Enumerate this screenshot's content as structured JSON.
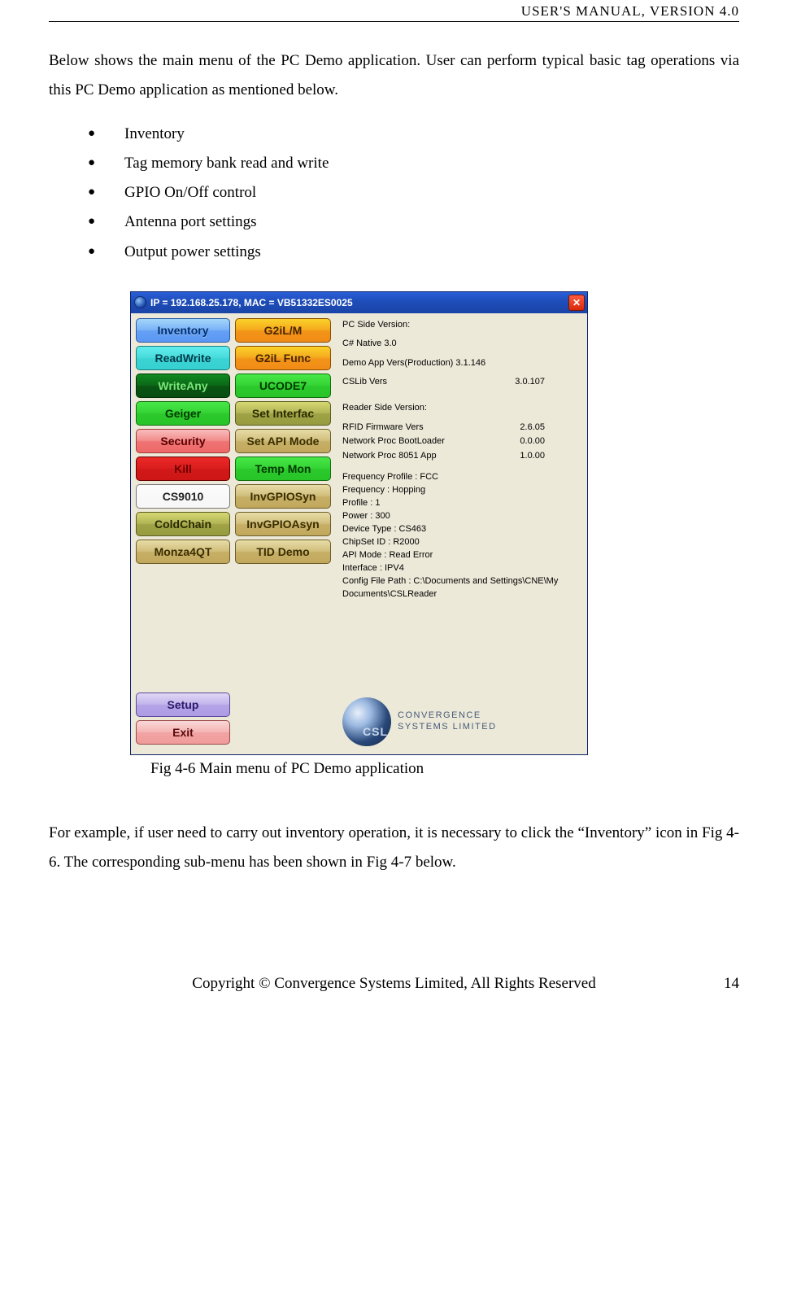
{
  "header": "USER'S  MANUAL,  VERSION  4.0",
  "intro": "Below shows the main menu of the PC Demo application. User can perform typical basic tag operations via this PC Demo application as mentioned below.",
  "features": [
    "Inventory",
    "Tag memory bank read and write",
    "GPIO On/Off control",
    "Antenna port settings",
    "Output power settings"
  ],
  "app": {
    "title": "IP = 192.168.25.178, MAC = VB51332ES0025",
    "close": "✕",
    "col1": [
      {
        "label": "Inventory",
        "cls": "b-blue"
      },
      {
        "label": "ReadWrite",
        "cls": "b-teal"
      },
      {
        "label": "WriteAny",
        "cls": "b-dgreen"
      },
      {
        "label": "Geiger",
        "cls": "b-green"
      },
      {
        "label": "Security",
        "cls": "b-salmon"
      },
      {
        "label": "Kill",
        "cls": "b-red"
      },
      {
        "label": "CS9010",
        "cls": "b-white"
      },
      {
        "label": "ColdChain",
        "cls": "b-olive"
      },
      {
        "label": "Monza4QT",
        "cls": "b-tan"
      }
    ],
    "col1_bottom": [
      {
        "label": "Setup",
        "cls": "b-violet"
      },
      {
        "label": "Exit",
        "cls": "b-pink"
      }
    ],
    "col2": [
      {
        "label": "G2iL/M",
        "cls": "b-orange"
      },
      {
        "label": "G2iL Func",
        "cls": "b-orange"
      },
      {
        "label": "UCODE7",
        "cls": "b-green"
      },
      {
        "label": "Set Interfac",
        "cls": "b-olive"
      },
      {
        "label": "Set API Mode",
        "cls": "b-tan"
      },
      {
        "label": "Temp Mon",
        "cls": "b-green"
      },
      {
        "label": "InvGPIOSyn",
        "cls": "b-tan"
      },
      {
        "label": "InvGPIOAsyn",
        "cls": "b-tan"
      },
      {
        "label": "TID Demo",
        "cls": "b-tan"
      }
    ],
    "info": {
      "pc_header": "PC Side Version:",
      "csharp": "C# Native 3.0",
      "demo_ver": "Demo App Vers(Production) 3.1.146",
      "cslib_lbl": "CSLib Vers",
      "cslib_val": "3.0.107",
      "reader_header": "Reader Side Version:",
      "rfid_lbl": "RFID Firmware Vers",
      "rfid_val": "2.6.05",
      "boot_lbl": "Network Proc BootLoader",
      "boot_val": "0.0.00",
      "net_lbl": "Network Proc  8051 App",
      "net_val": "1.0.00",
      "freq_profile": "Frequency Profile : FCC",
      "freq": "Frequency : Hopping",
      "profile": "Profile : 1",
      "power": "Power : 300",
      "device": "Device Type :  CS463",
      "chipset": "ChipSet ID : R2000",
      "api": "API Mode : Read Error",
      "iface": "Interface : IPV4",
      "cfg": "Config File Path : C:\\Documents and Settings\\CNE\\My Documents\\CSLReader"
    },
    "logo_line1": "CONVERGENCE",
    "logo_line2": "SYSTEMS LIMITED"
  },
  "caption": "Fig 4-6 Main menu of PC Demo application",
  "para2": "For example, if user need to carry out inventory operation, it is necessary to click the “Inventory” icon in Fig 4-6. The corresponding sub-menu has been shown in Fig 4-7 below.",
  "footer": "Copyright © Convergence Systems Limited, All Rights Reserved",
  "page_num": "14"
}
